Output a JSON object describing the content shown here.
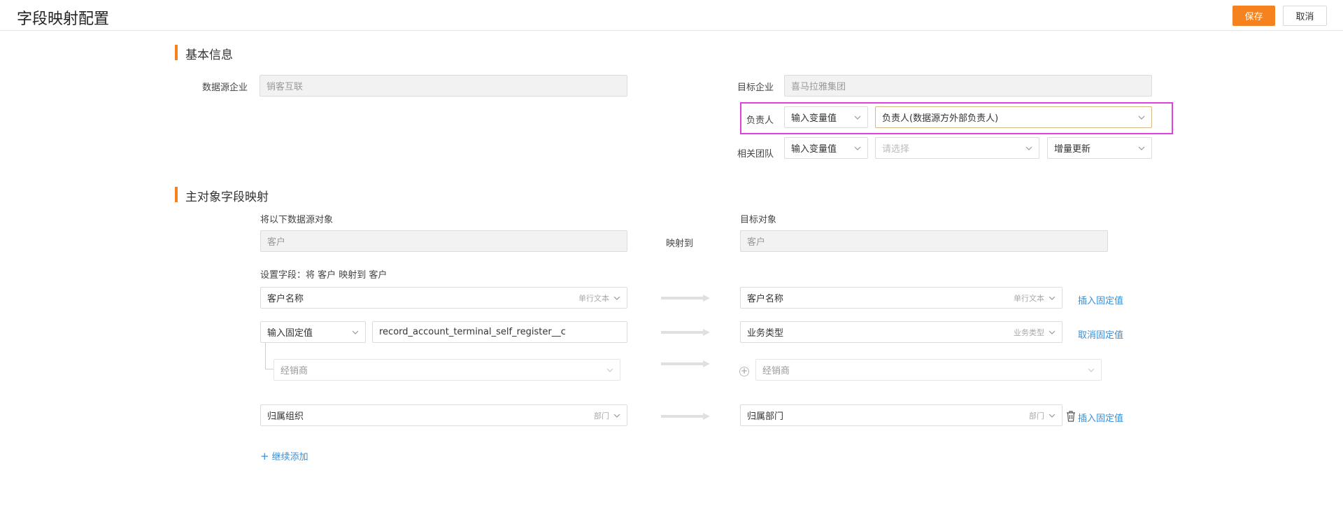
{
  "header": {
    "title": "字段映射配置",
    "save_label": "保存",
    "cancel_label": "取消"
  },
  "basic": {
    "section_title": "基本信息",
    "source_label": "数据源企业",
    "source_value": "销客互联",
    "target_label": "目标企业",
    "target_value": "喜马拉雅集团",
    "owner_label": "负责人",
    "owner_mode": "输入变量值",
    "owner_value": "负责人(数据源方外部负责人)",
    "team_label": "相关团队",
    "team_mode": "输入变量值",
    "team_placeholder": "请选择",
    "team_update": "增量更新"
  },
  "mapping": {
    "section_title": "主对象字段映射",
    "source_obj_label": "将以下数据源对象",
    "source_obj_value": "客户",
    "map_to_label": "映射到",
    "target_obj_label": "目标对象",
    "target_obj_value": "客户",
    "set_fields_text": "设置字段：将 客户 映射到 客户",
    "rows": [
      {
        "src": "客户名称",
        "src_type": "单行文本",
        "tgt": "客户名称",
        "tgt_type": "单行文本",
        "action": "插入固定值"
      },
      {
        "src_mode": "输入固定值",
        "src_value": "record_account_terminal_self_register__c",
        "tgt": "业务类型",
        "tgt_type": "业务类型",
        "action": "取消固定值"
      },
      {
        "src_sub": "经销商",
        "tgt_sub": "经销商"
      },
      {
        "src": "归属组织",
        "src_type": "部门",
        "tgt": "归属部门",
        "tgt_type": "部门",
        "action": "插入固定值"
      }
    ],
    "add_more_label": "继续添加"
  },
  "colors": {
    "accent": "#f5821f",
    "link": "#3b8fd8",
    "highlight": "#e040e0"
  }
}
